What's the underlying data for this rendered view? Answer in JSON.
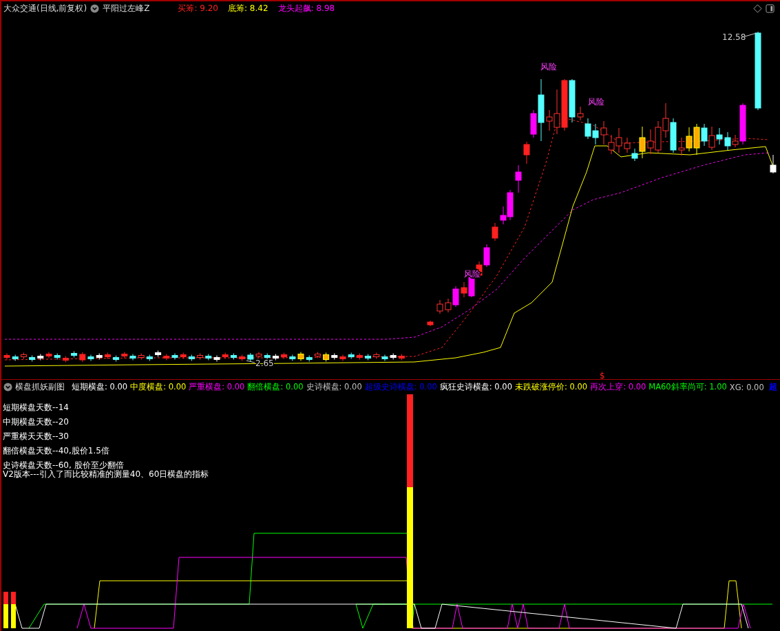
{
  "main_panel": {
    "title": "大众交通(日线,前复权)",
    "indicator_name": "平阳过左峰Z",
    "values": [
      {
        "label": "买筹:",
        "value": "9.20",
        "color": "#ff2020"
      },
      {
        "label": "底筹:",
        "value": "8.42",
        "color": "#ffff00"
      },
      {
        "label": "龙头起飙:",
        "value": "8.98",
        "color": "#ff00ff"
      }
    ],
    "chart_markers": [
      "风险",
      "风险",
      "风险"
    ],
    "price_labels": [
      "12.58",
      "2.65"
    ],
    "signal_mark": "$"
  },
  "sub_panel": {
    "title": "横盘抓妖副图",
    "values": [
      {
        "label": "短期横盘:",
        "value": "0.00",
        "color": "#ffffff"
      },
      {
        "label": "中度横盘:",
        "value": "0.00",
        "color": "#ffff00"
      },
      {
        "label": "严重横盘:",
        "value": "0.00",
        "color": "#ff00ff"
      },
      {
        "label": "翻倍横盘:",
        "value": "0.00",
        "color": "#00ff00"
      },
      {
        "label": "史诗横盘:",
        "value": "0.00",
        "color": "#c0c0c0"
      },
      {
        "label": "超级史诗横盘:",
        "value": "0.00",
        "color": "#0000ff"
      },
      {
        "label": "疯狂史诗横盘:",
        "value": "0.00",
        "color": "#ffffff"
      },
      {
        "label": "未跌破涨停价:",
        "value": "0.00",
        "color": "#ffff00"
      },
      {
        "label": "再次上穿:",
        "value": "0.00",
        "color": "#ff00ff"
      },
      {
        "label": "MA60斜率尚可:",
        "value": "1.00",
        "color": "#00ff00"
      },
      {
        "label": "XG:",
        "value": "0.00",
        "color": "#c0c0c0"
      }
    ],
    "cut_label": {
      "text": "超",
      "color": "#0000ff"
    },
    "notes": [
      "短期横盘天数--14",
      "中期横盘天数--20",
      "严重横天天数--30",
      "翻倍横盘天数--40,股价1.5倍",
      "史诗横盘天数--60, 股价至少翻倍",
      "V2版本---引入了而比较精准的测量40、60日横盘的指标"
    ]
  }
}
